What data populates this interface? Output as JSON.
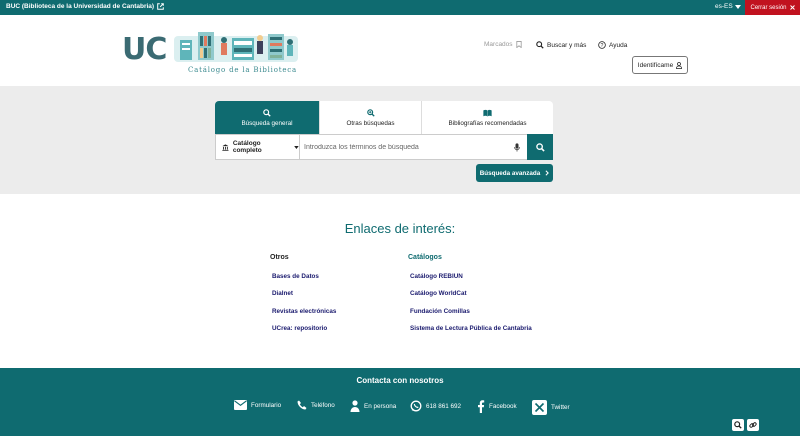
{
  "topbar": {
    "site_label": "BUC (Biblioteca de la Universidad de Cantabria)",
    "language": "es-ES",
    "logout_label": "Cerrar sesión"
  },
  "header": {
    "logo_text": "UC",
    "logo_caption": "Catálogo de la Biblioteca",
    "marcados_label": "Marcados",
    "buscar_label": "Buscar y más",
    "ayuda_label": "Ayuda",
    "identify_label": "Identifícame"
  },
  "search": {
    "tabs": [
      {
        "label": "Búsqueda general",
        "icon": "search-icon",
        "active": true
      },
      {
        "label": "Otras búsquedas",
        "icon": "zoom-plus-icon",
        "active": false
      },
      {
        "label": "Bibliografías recomendadas",
        "icon": "book-open-icon",
        "active": false
      }
    ],
    "scope_label": "Catálogo completo",
    "placeholder": "Introduzca los términos de búsqueda",
    "advanced_label": "Búsqueda avanzada"
  },
  "links": {
    "title": "Enlaces de interés:",
    "otros": {
      "heading": "Otros",
      "items": [
        "Bases de Datos",
        "Dialnet",
        "Revistas electrónicas",
        "UCrea: repositorio"
      ]
    },
    "catalogos": {
      "heading": "Catálogos",
      "items": [
        "Catálogo REBIUN",
        "Catálogo WorldCat",
        "Fundación Comillas",
        "Sistema de Lectura Pública de Cantabria"
      ]
    }
  },
  "footer": {
    "title": "Contacta con nosotros",
    "contacts": [
      {
        "label": "Formulario",
        "icon": "envelope-icon"
      },
      {
        "label": "Teléfono",
        "icon": "phone-icon"
      },
      {
        "label": "En persona",
        "icon": "person-icon"
      },
      {
        "label": "618 861 692",
        "icon": "whatsapp-icon"
      },
      {
        "label": "Facebook",
        "icon": "facebook-icon"
      },
      {
        "label": "Twitter",
        "icon": "x-twitter-icon"
      }
    ]
  },
  "colors": {
    "brand": "#0f6b70",
    "logout": "#c1121f",
    "link": "#1a1a6e"
  }
}
